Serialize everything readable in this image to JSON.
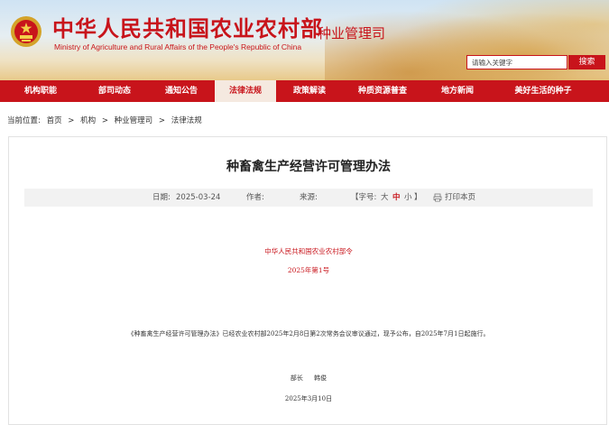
{
  "header": {
    "site_title": "中华人民共和国农业农村部",
    "site_subtitle": "Ministry of Agriculture and Rural Affairs of the People's Republic of China",
    "dept_name": "种业管理司",
    "search_placeholder": "请输入关键字",
    "search_button": "搜索"
  },
  "nav": {
    "items": [
      {
        "label": "机构职能"
      },
      {
        "label": "部司动态"
      },
      {
        "label": "通知公告"
      },
      {
        "label": "法律法规"
      },
      {
        "label": "政策解读"
      },
      {
        "label": "种质资源普查"
      },
      {
        "label": "地方新闻"
      },
      {
        "label": "美好生活的种子"
      }
    ],
    "active_index": 3
  },
  "breadcrumb": {
    "prefix": "当前位置:",
    "items": [
      "首页",
      "机构",
      "种业管理司",
      "法律法规"
    ],
    "separator": ">"
  },
  "article": {
    "title": "种畜禽生产经营许可管理办法",
    "meta": {
      "date_label": "日期:",
      "date": "2025-03-24",
      "author_label": "作者:",
      "source_label": "来源:",
      "font_open": "【字号:",
      "font_large": "大",
      "font_medium": "中",
      "font_small": "小",
      "font_close": "】",
      "print_label": "打印本页"
    },
    "issuer": "中华人民共和国农业农村部令",
    "doc_number": "2025年第1号",
    "body": "《种畜禽生产经营许可管理办法》已经农业农村部2025年2月8日第2次常务会议审议通过，现予公布，自2025年7月1日起施行。",
    "signer_title": "部长",
    "signer_name": "韩俊",
    "sign_date": "2025年3月10日"
  },
  "colors": {
    "brand_red": "#c8141b",
    "nav_active_bg": "#f5e9e0",
    "meta_bg": "#f2f2f2"
  }
}
